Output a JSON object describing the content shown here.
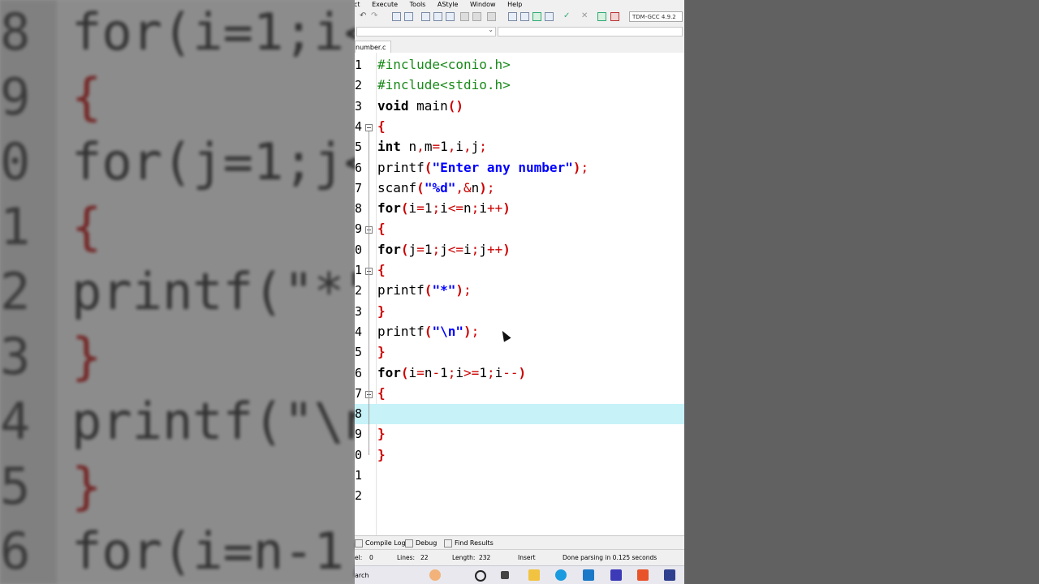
{
  "menu": {
    "items": [
      "ct",
      "Execute",
      "Tools",
      "AStyle",
      "Window",
      "Help"
    ]
  },
  "toolbar": {
    "compiler": "TDM-GCC 4.9.2"
  },
  "file_tab": {
    "label": "number.c"
  },
  "editor": {
    "lines": [
      {
        "num": "1",
        "text": "#include<conio.h>"
      },
      {
        "num": "2",
        "text": "#include<stdio.h>"
      },
      {
        "num": "3",
        "text": "void main()"
      },
      {
        "num": "4",
        "text": "{"
      },
      {
        "num": "5",
        "text": "int n,m=1,i,j;"
      },
      {
        "num": "6",
        "text": "printf(\"Enter any number\");"
      },
      {
        "num": "7",
        "text": "scanf(\"%d\",&n);"
      },
      {
        "num": "8",
        "text": "for(i=1;i<=n;i++)"
      },
      {
        "num": "9",
        "text": "{"
      },
      {
        "num": "0",
        "text": "for(j=1;j<=i;j++)"
      },
      {
        "num": "1",
        "text": "{"
      },
      {
        "num": "2",
        "text": "printf(\"*\");"
      },
      {
        "num": "3",
        "text": "}"
      },
      {
        "num": "4",
        "text": "printf(\"\\n\");"
      },
      {
        "num": "5",
        "text": "}"
      },
      {
        "num": "6",
        "text": "for(i=n-1;i>=1;i--)"
      },
      {
        "num": "7",
        "text": "{"
      },
      {
        "num": "8",
        "text": ""
      },
      {
        "num": "9",
        "text": "}"
      },
      {
        "num": "0",
        "text": "}"
      },
      {
        "num": "1",
        "text": ""
      },
      {
        "num": "2",
        "text": ""
      }
    ]
  },
  "bottom_tabs": {
    "compile_log": "Compile Log",
    "debug": "Debug",
    "find_results": "Find Results"
  },
  "status": {
    "col_label": "el:",
    "col_value": "0",
    "lines_label": "Lines:",
    "lines_value": "22",
    "length_label": "Length:",
    "length_value": "232",
    "mode": "Insert",
    "message": "Done parsing in 0.125 seconds"
  },
  "taskbar": {
    "search_label": "arch"
  },
  "background": {
    "lines": [
      {
        "num": "8",
        "text": "for(i=1;i<"
      },
      {
        "num": "9",
        "text": "{"
      },
      {
        "num": "0",
        "text": "for(j=1;j<"
      },
      {
        "num": "1",
        "text": "{"
      },
      {
        "num": "2",
        "text": "printf(\"*\""
      },
      {
        "num": "3",
        "text": "}"
      },
      {
        "num": "4",
        "text": "printf(\"\\n"
      },
      {
        "num": "5",
        "text": "}"
      },
      {
        "num": "6",
        "text": "for(i=n-1;"
      }
    ]
  },
  "colors": {
    "active_line": "#c6f2f8",
    "preprocessor": "#1a8a1a",
    "brace": "#cc0000",
    "string": "#0000ff"
  }
}
